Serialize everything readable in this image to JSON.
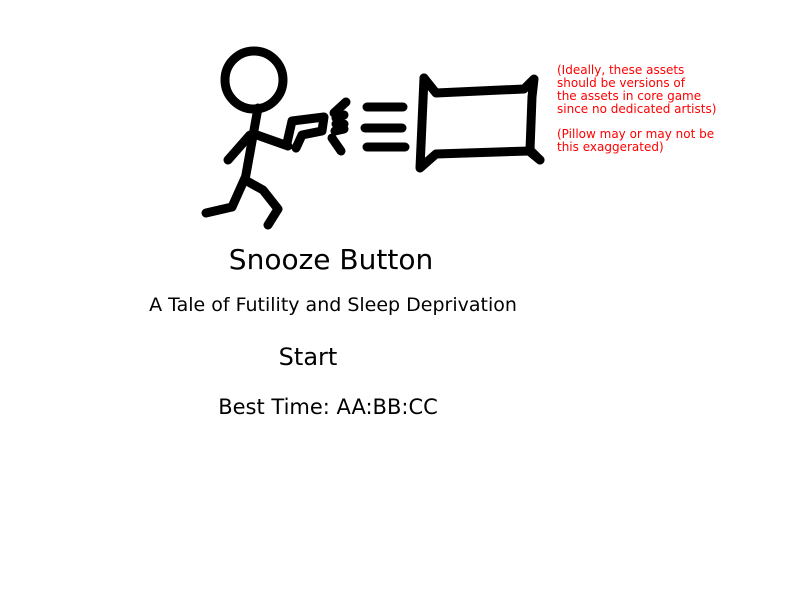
{
  "menu": {
    "title": "Snooze Button",
    "subtitle": "A Tale of Futility and Sleep Deprivation",
    "start_label": "Start",
    "best_time_label": "Best Time: AA:BB:CC"
  },
  "notes": {
    "assets_note": "(Ideally, these assets\nshould be versions of\nthe assets in core game\nsince no dedicated artists)",
    "pillow_note": "(Pillow may or may not be\nthis exaggerated)"
  },
  "illustration": {
    "figure": "stick-figure",
    "weapon": "blaster",
    "projectile": "pillow"
  },
  "colors": {
    "background": "#ffffff",
    "ink": "#000000",
    "annotation": "#ff0000"
  }
}
